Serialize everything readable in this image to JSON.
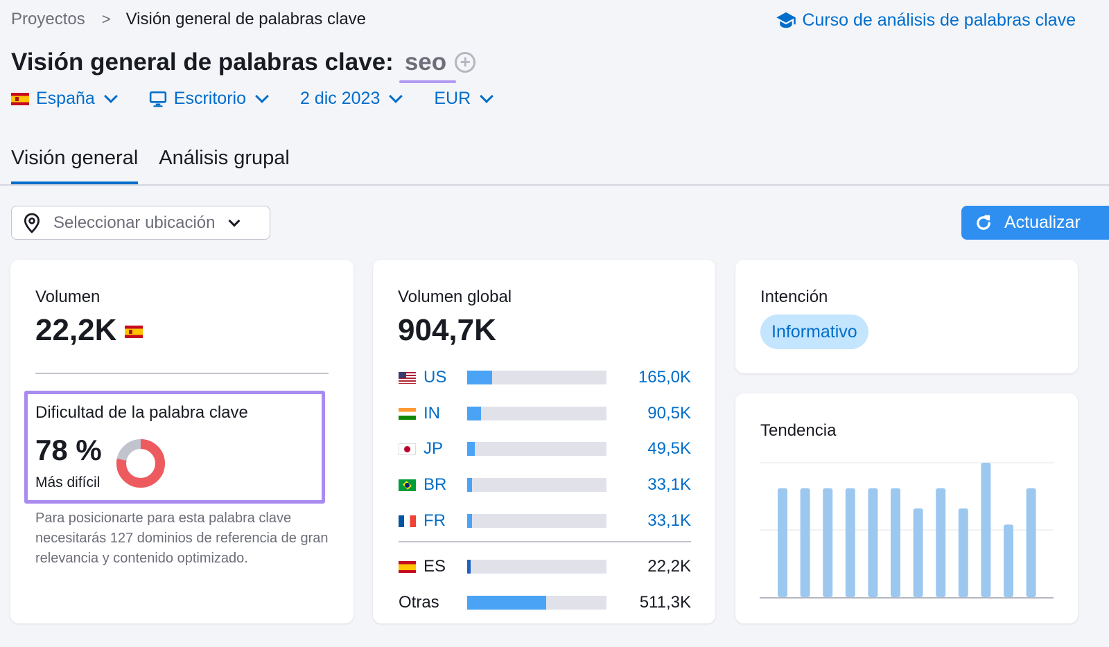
{
  "breadcrumb": {
    "root": "Proyectos",
    "separator": ">",
    "current": "Visión general de palabras clave"
  },
  "course_link": {
    "label": "Curso de análisis de palabras clave",
    "icon": "graduation-cap-icon"
  },
  "header": {
    "title": "Visión general de palabras clave:",
    "keyword": "seo",
    "add_icon": "plus-circle-icon"
  },
  "filters": {
    "country": "España",
    "device": "Escritorio",
    "date": "2 dic 2023",
    "currency": "EUR"
  },
  "tabs": [
    {
      "label": "Visión general",
      "active": true
    },
    {
      "label": "Análisis grupal",
      "active": false
    }
  ],
  "location": {
    "placeholder": "Seleccionar ubicación"
  },
  "refresh": {
    "label": "Actualizar"
  },
  "volume": {
    "label": "Volumen",
    "value": "22,2K"
  },
  "difficulty": {
    "label": "Dificultad de la palabra clave",
    "value": "78 %",
    "level": "Más difícil",
    "percent": 78,
    "color": "#ee5b5f",
    "description": "Para posicionarte para esta palabra clave necesitarás 127 dominios de referencia de gran relevancia y contenido optimizado."
  },
  "global_volume": {
    "label": "Volumen global",
    "value": "904,7K",
    "countries": [
      {
        "code": "US",
        "value": "165,0K",
        "fill": 0.18
      },
      {
        "code": "IN",
        "value": "90,5K",
        "fill": 0.1
      },
      {
        "code": "JP",
        "value": "49,5K",
        "fill": 0.055
      },
      {
        "code": "BR",
        "value": "33,1K",
        "fill": 0.037
      },
      {
        "code": "FR",
        "value": "33,1K",
        "fill": 0.037
      }
    ],
    "local": {
      "code": "ES",
      "value": "22,2K",
      "fill": 0.025
    },
    "others": {
      "label": "Otras",
      "value": "511,3K",
      "fill": 0.565
    }
  },
  "intent": {
    "label": "Intención",
    "value": "Informativo"
  },
  "trend": {
    "label": "Tendencia",
    "bar_color": "#9cc8f0"
  },
  "chart_data": {
    "type": "bar",
    "title": "Tendencia",
    "categories": [
      "1",
      "2",
      "3",
      "4",
      "5",
      "6",
      "7",
      "8",
      "9",
      "10",
      "11",
      "12"
    ],
    "values": [
      0.81,
      0.81,
      0.81,
      0.81,
      0.81,
      0.81,
      0.66,
      0.81,
      0.66,
      1.0,
      0.54,
      0.81
    ],
    "ylim": [
      0,
      1
    ],
    "grid": true
  }
}
